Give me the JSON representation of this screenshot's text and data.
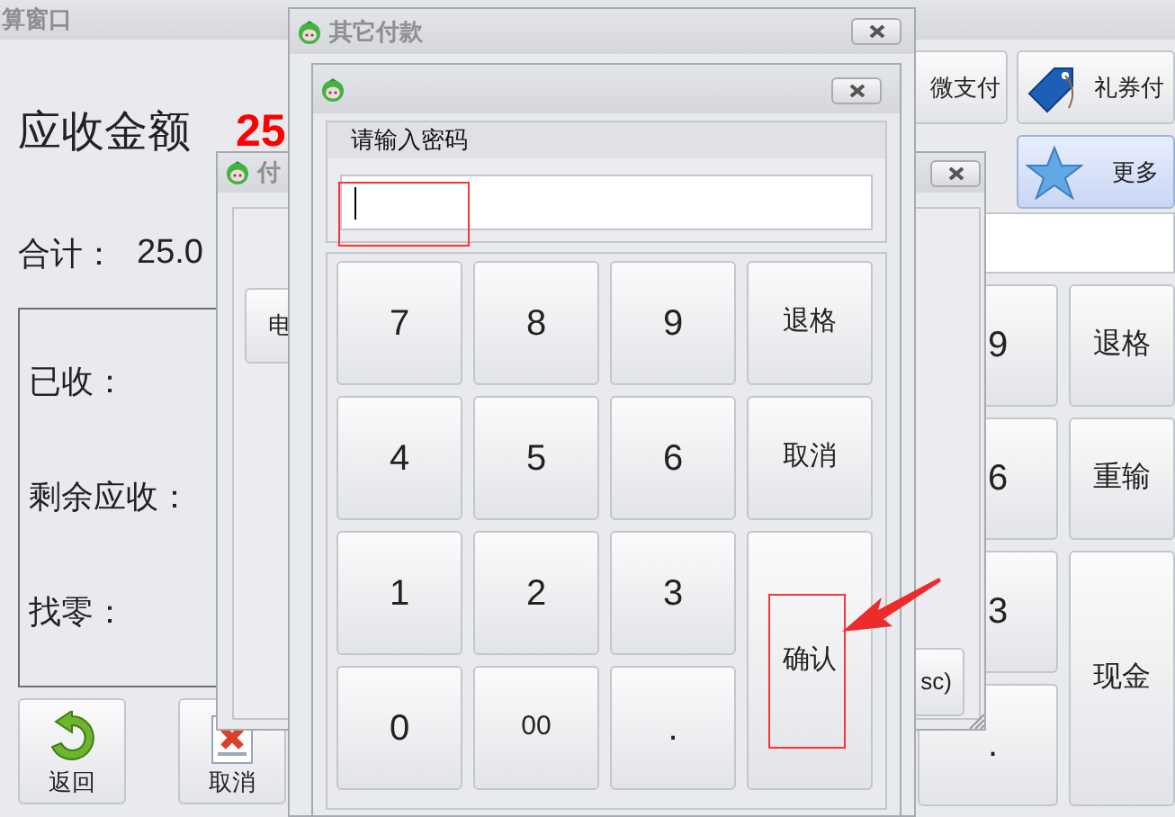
{
  "main_window": {
    "title": "算窗口",
    "amount_label": "应收金额",
    "amount": "25",
    "total_label": "合计：",
    "total": "25.0",
    "summary": [
      "已收：",
      "剩余应收：",
      "找零："
    ],
    "bottom_buttons": [
      "返回",
      "取消"
    ],
    "pay_buttons": [
      {
        "label": "微支付",
        "selected": false
      },
      {
        "label": "礼券付",
        "selected": false
      },
      {
        "label": "更多",
        "selected": true
      }
    ],
    "keypad": [
      {
        "label": "9",
        "kind": "key"
      },
      {
        "label": "退格",
        "kind": "key"
      },
      {
        "label": "6",
        "kind": "key"
      },
      {
        "label": "重输",
        "kind": "key"
      },
      {
        "label": "3",
        "kind": "key"
      },
      {
        "label": "现金",
        "kind": "tall"
      },
      {
        "label": ".",
        "kind": "key"
      }
    ]
  },
  "payment_window": {
    "title": "付",
    "buttons": [
      "电",
      "sc)"
    ]
  },
  "other_payment_window": {
    "title": "其它付款"
  },
  "password_dialog": {
    "group_label": "请输入密码",
    "keypad": [
      {
        "label": "7",
        "kind": "key"
      },
      {
        "label": "8",
        "kind": "key"
      },
      {
        "label": "9",
        "kind": "key"
      },
      {
        "label": "退格",
        "kind": "key"
      },
      {
        "label": "4",
        "kind": "key"
      },
      {
        "label": "5",
        "kind": "key"
      },
      {
        "label": "6",
        "kind": "key"
      },
      {
        "label": "取消",
        "kind": "key"
      },
      {
        "label": "1",
        "kind": "key"
      },
      {
        "label": "2",
        "kind": "key"
      },
      {
        "label": "3",
        "kind": "key"
      },
      {
        "label": "确认",
        "kind": "tall"
      },
      {
        "label": "0",
        "kind": "key"
      },
      {
        "label": "00",
        "kind": "key"
      },
      {
        "label": ".",
        "kind": "key"
      }
    ]
  }
}
